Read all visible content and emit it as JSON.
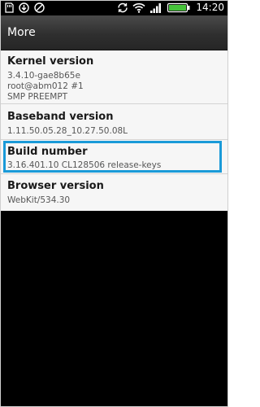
{
  "status_bar": {
    "time": "14:20",
    "icons": [
      "sd-card-icon",
      "download-icon",
      "cancel-icon",
      "sync-icon",
      "wifi-icon",
      "signal-icon",
      "battery-icon"
    ]
  },
  "title_bar": {
    "title": "More"
  },
  "items": [
    {
      "title": "Kernel version",
      "value": "3.4.10-gae8b65e\nroot@abm012 #1\nSMP PREEMPT"
    },
    {
      "title": "Baseband version",
      "value": "1.11.50.05.28_10.27.50.08L"
    },
    {
      "title": "Build number",
      "value": "3.16.401.10 CL128506 release-keys"
    },
    {
      "title": "Browser version",
      "value": "WebKit/534.30"
    }
  ],
  "colors": {
    "highlight": "#1a9ad8",
    "battery": "#46c23a"
  }
}
